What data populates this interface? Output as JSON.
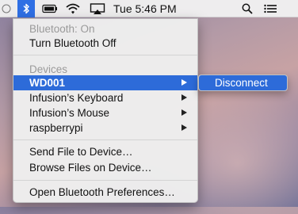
{
  "menubar": {
    "clock": "Tue 5:46 PM",
    "icons": [
      "finder-dot-icon",
      "bluetooth-icon",
      "battery-icon",
      "wifi-icon",
      "airplay-icon",
      "search-icon",
      "notification-list-icon"
    ]
  },
  "bluetooth_menu": {
    "status": "Bluetooth: On",
    "toggle": "Turn Bluetooth Off",
    "devices_header": "Devices",
    "devices": [
      {
        "name": "WD001",
        "selected": true
      },
      {
        "name": "Infusion’s Keyboard",
        "selected": false
      },
      {
        "name": "Infusion’s Mouse",
        "selected": false
      },
      {
        "name": "raspberrypi",
        "selected": false
      }
    ],
    "send_file": "Send File to Device…",
    "browse_files": "Browse Files on Device…",
    "open_prefs": "Open Bluetooth Preferences…"
  },
  "submenu": {
    "disconnect": "Disconnect"
  },
  "colors": {
    "highlight": "#2d6bd9",
    "menubar_active": "#2f6fe4"
  }
}
